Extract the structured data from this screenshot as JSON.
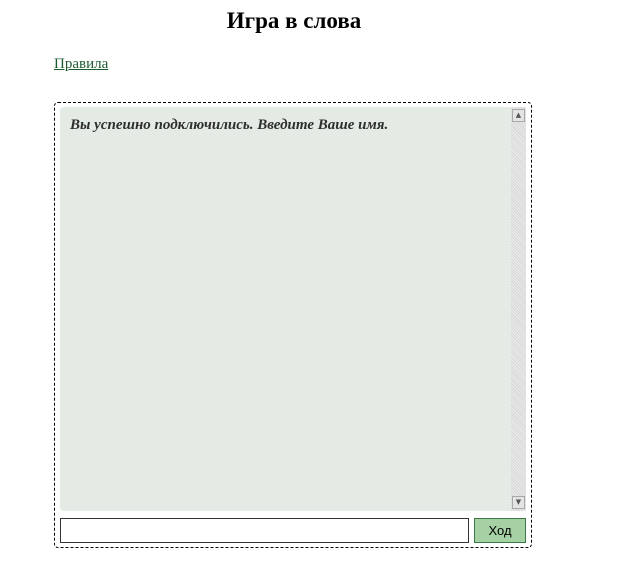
{
  "page": {
    "title": "Игра в слова",
    "rules_link": "Правила"
  },
  "game": {
    "log_messages": [
      "Вы успешно подключились. Введите Ваше имя."
    ],
    "input": {
      "value": "",
      "placeholder": ""
    },
    "move_button_label": "Ход",
    "scroll_up_glyph": "▲",
    "scroll_down_glyph": "▼"
  },
  "colors": {
    "log_background": "#e3ebe4",
    "button_background": "#a6d1a4",
    "link": "#1e5a30"
  }
}
